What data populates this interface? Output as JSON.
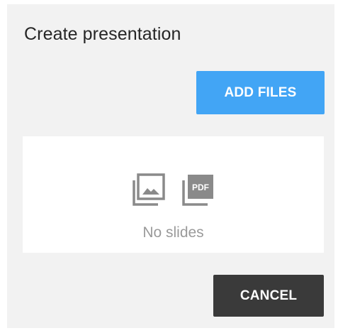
{
  "dialog": {
    "title": "Create presentation",
    "add_files_label": "ADD FILES",
    "cancel_label": "CANCEL"
  },
  "dropzone": {
    "empty_text": "No slides",
    "icons": [
      "image-stack-icon",
      "pdf-stack-icon"
    ],
    "icon_text": "PDF"
  },
  "colors": {
    "accent": "#42a5f5",
    "cancel": "#3a3a3a",
    "panel": "#f2f2f2"
  }
}
